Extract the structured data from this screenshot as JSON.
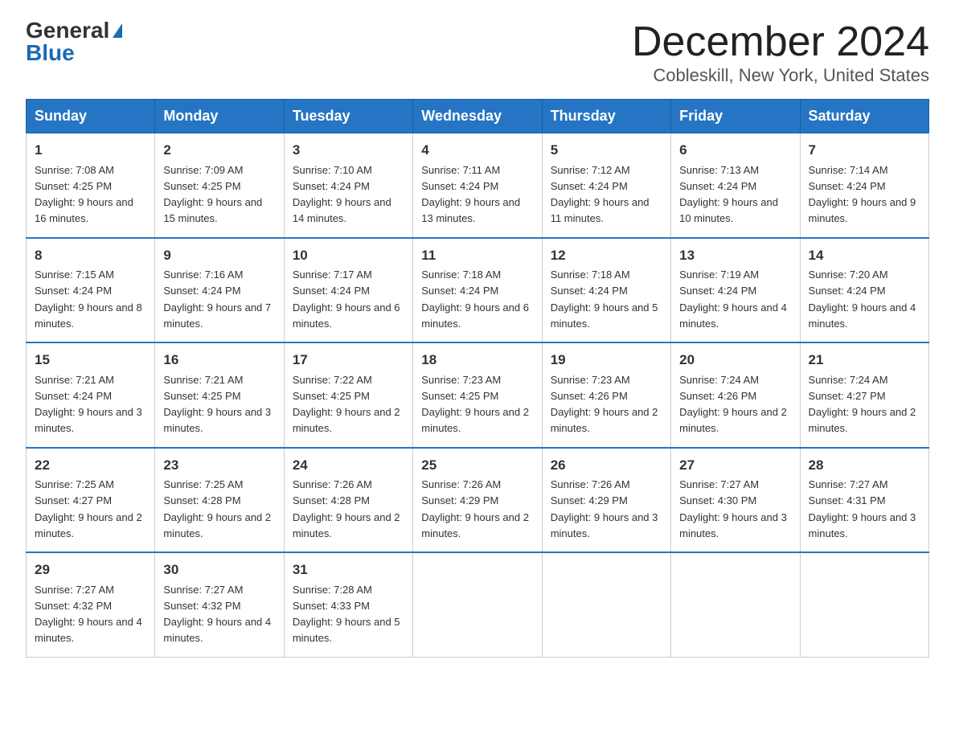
{
  "header": {
    "logo_general": "General",
    "logo_blue": "Blue",
    "month_title": "December 2024",
    "location": "Cobleskill, New York, United States"
  },
  "days_of_week": [
    "Sunday",
    "Monday",
    "Tuesday",
    "Wednesday",
    "Thursday",
    "Friday",
    "Saturday"
  ],
  "weeks": [
    [
      {
        "day": "1",
        "sunrise": "7:08 AM",
        "sunset": "4:25 PM",
        "daylight": "9 hours and 16 minutes."
      },
      {
        "day": "2",
        "sunrise": "7:09 AM",
        "sunset": "4:25 PM",
        "daylight": "9 hours and 15 minutes."
      },
      {
        "day": "3",
        "sunrise": "7:10 AM",
        "sunset": "4:24 PM",
        "daylight": "9 hours and 14 minutes."
      },
      {
        "day": "4",
        "sunrise": "7:11 AM",
        "sunset": "4:24 PM",
        "daylight": "9 hours and 13 minutes."
      },
      {
        "day": "5",
        "sunrise": "7:12 AM",
        "sunset": "4:24 PM",
        "daylight": "9 hours and 11 minutes."
      },
      {
        "day": "6",
        "sunrise": "7:13 AM",
        "sunset": "4:24 PM",
        "daylight": "9 hours and 10 minutes."
      },
      {
        "day": "7",
        "sunrise": "7:14 AM",
        "sunset": "4:24 PM",
        "daylight": "9 hours and 9 minutes."
      }
    ],
    [
      {
        "day": "8",
        "sunrise": "7:15 AM",
        "sunset": "4:24 PM",
        "daylight": "9 hours and 8 minutes."
      },
      {
        "day": "9",
        "sunrise": "7:16 AM",
        "sunset": "4:24 PM",
        "daylight": "9 hours and 7 minutes."
      },
      {
        "day": "10",
        "sunrise": "7:17 AM",
        "sunset": "4:24 PM",
        "daylight": "9 hours and 6 minutes."
      },
      {
        "day": "11",
        "sunrise": "7:18 AM",
        "sunset": "4:24 PM",
        "daylight": "9 hours and 6 minutes."
      },
      {
        "day": "12",
        "sunrise": "7:18 AM",
        "sunset": "4:24 PM",
        "daylight": "9 hours and 5 minutes."
      },
      {
        "day": "13",
        "sunrise": "7:19 AM",
        "sunset": "4:24 PM",
        "daylight": "9 hours and 4 minutes."
      },
      {
        "day": "14",
        "sunrise": "7:20 AM",
        "sunset": "4:24 PM",
        "daylight": "9 hours and 4 minutes."
      }
    ],
    [
      {
        "day": "15",
        "sunrise": "7:21 AM",
        "sunset": "4:24 PM",
        "daylight": "9 hours and 3 minutes."
      },
      {
        "day": "16",
        "sunrise": "7:21 AM",
        "sunset": "4:25 PM",
        "daylight": "9 hours and 3 minutes."
      },
      {
        "day": "17",
        "sunrise": "7:22 AM",
        "sunset": "4:25 PM",
        "daylight": "9 hours and 2 minutes."
      },
      {
        "day": "18",
        "sunrise": "7:23 AM",
        "sunset": "4:25 PM",
        "daylight": "9 hours and 2 minutes."
      },
      {
        "day": "19",
        "sunrise": "7:23 AM",
        "sunset": "4:26 PM",
        "daylight": "9 hours and 2 minutes."
      },
      {
        "day": "20",
        "sunrise": "7:24 AM",
        "sunset": "4:26 PM",
        "daylight": "9 hours and 2 minutes."
      },
      {
        "day": "21",
        "sunrise": "7:24 AM",
        "sunset": "4:27 PM",
        "daylight": "9 hours and 2 minutes."
      }
    ],
    [
      {
        "day": "22",
        "sunrise": "7:25 AM",
        "sunset": "4:27 PM",
        "daylight": "9 hours and 2 minutes."
      },
      {
        "day": "23",
        "sunrise": "7:25 AM",
        "sunset": "4:28 PM",
        "daylight": "9 hours and 2 minutes."
      },
      {
        "day": "24",
        "sunrise": "7:26 AM",
        "sunset": "4:28 PM",
        "daylight": "9 hours and 2 minutes."
      },
      {
        "day": "25",
        "sunrise": "7:26 AM",
        "sunset": "4:29 PM",
        "daylight": "9 hours and 2 minutes."
      },
      {
        "day": "26",
        "sunrise": "7:26 AM",
        "sunset": "4:29 PM",
        "daylight": "9 hours and 3 minutes."
      },
      {
        "day": "27",
        "sunrise": "7:27 AM",
        "sunset": "4:30 PM",
        "daylight": "9 hours and 3 minutes."
      },
      {
        "day": "28",
        "sunrise": "7:27 AM",
        "sunset": "4:31 PM",
        "daylight": "9 hours and 3 minutes."
      }
    ],
    [
      {
        "day": "29",
        "sunrise": "7:27 AM",
        "sunset": "4:32 PM",
        "daylight": "9 hours and 4 minutes."
      },
      {
        "day": "30",
        "sunrise": "7:27 AM",
        "sunset": "4:32 PM",
        "daylight": "9 hours and 4 minutes."
      },
      {
        "day": "31",
        "sunrise": "7:28 AM",
        "sunset": "4:33 PM",
        "daylight": "9 hours and 5 minutes."
      },
      null,
      null,
      null,
      null
    ]
  ]
}
